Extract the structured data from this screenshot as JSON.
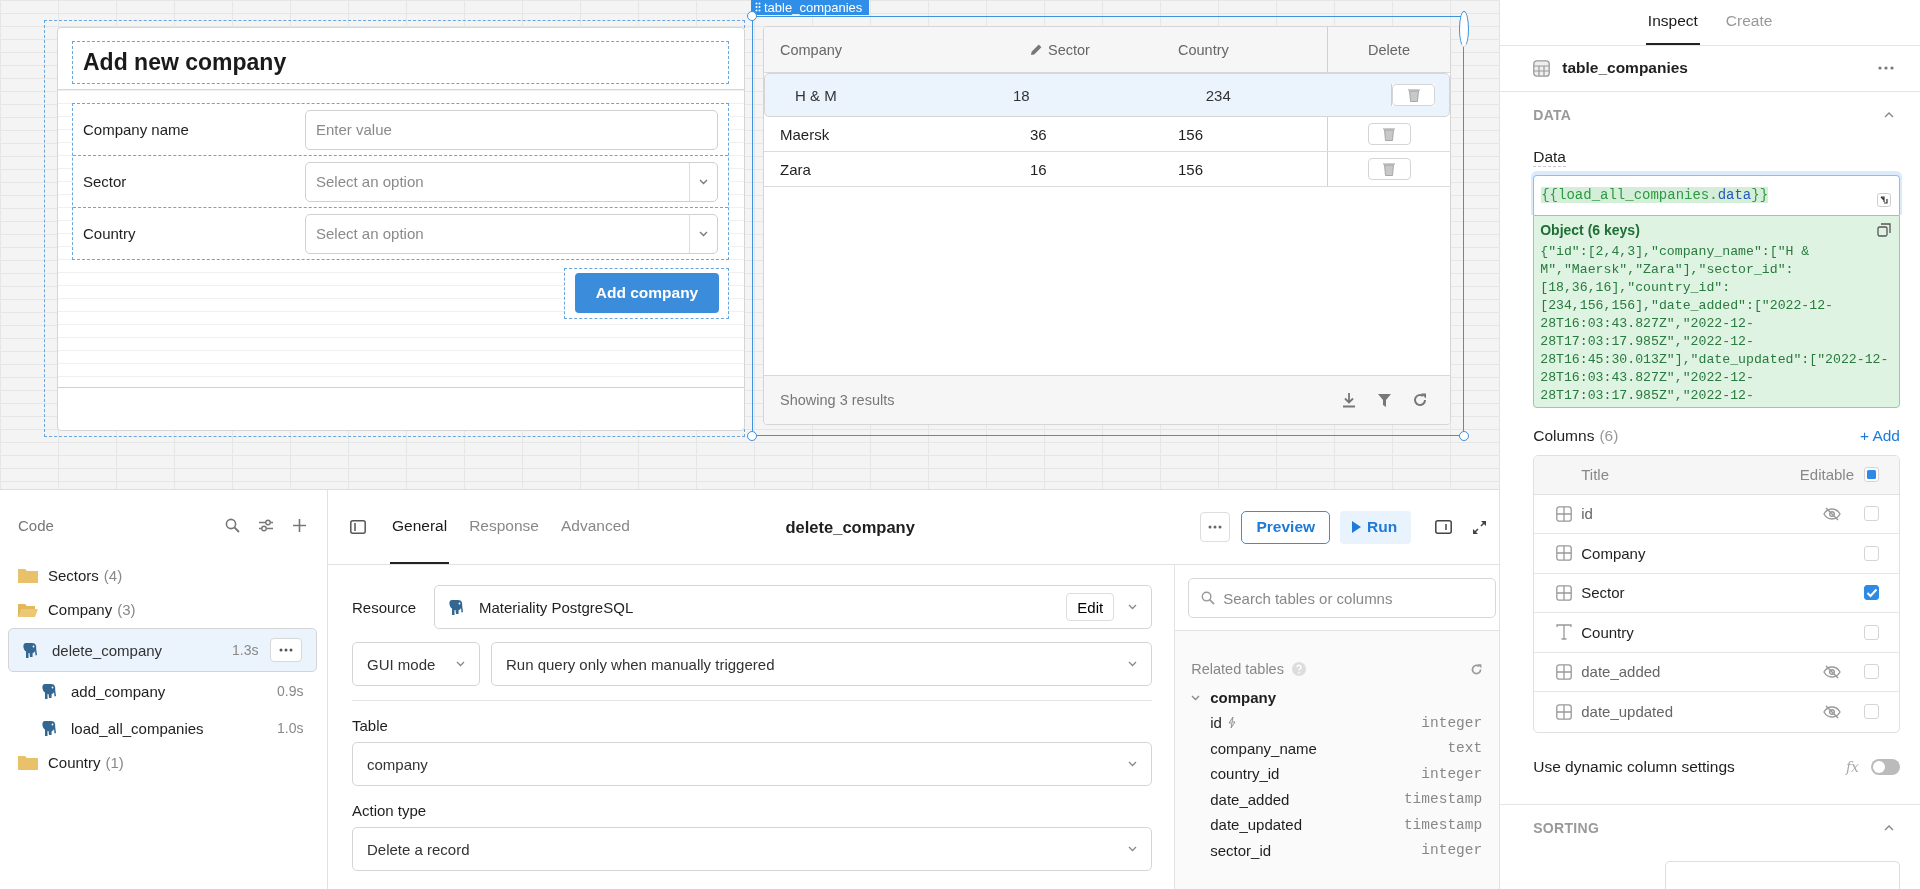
{
  "canvas": {
    "form": {
      "title": "Add new company",
      "fields": [
        {
          "label": "Company name",
          "placeholder": "Enter value",
          "kind": "text"
        },
        {
          "label": "Sector",
          "placeholder": "Select an option",
          "kind": "select"
        },
        {
          "label": "Country",
          "placeholder": "Select an option",
          "kind": "select"
        }
      ],
      "submit_button": "Add company"
    },
    "table": {
      "component_name": "table_companies",
      "columns": [
        {
          "label": "Company",
          "editable": false
        },
        {
          "label": "Sector",
          "editable": true
        },
        {
          "label": "Country",
          "editable": false
        }
      ],
      "action_column": "Delete",
      "rows": [
        {
          "cells": [
            "H & M",
            "18",
            "234"
          ],
          "selected": true
        },
        {
          "cells": [
            "Maersk",
            "36",
            "156"
          ],
          "selected": false
        },
        {
          "cells": [
            "Zara",
            "16",
            "156"
          ],
          "selected": false
        }
      ],
      "footer": "Showing 3 results"
    }
  },
  "code_panel": {
    "title": "Code",
    "tree": [
      {
        "label": "Sectors",
        "count": "(4)",
        "expanded": false
      },
      {
        "label": "Company",
        "count": "(3)",
        "expanded": true,
        "children": [
          {
            "label": "delete_company",
            "time": "1.3s",
            "selected": true
          },
          {
            "label": "add_company",
            "time": "0.9s",
            "selected": false
          },
          {
            "label": "load_all_companies",
            "time": "1.0s",
            "selected": false
          }
        ]
      },
      {
        "label": "Country",
        "count": "(1)",
        "expanded": false
      }
    ]
  },
  "query_editor": {
    "tabs": [
      {
        "label": "General",
        "selected": true
      },
      {
        "label": "Response",
        "selected": false
      },
      {
        "label": "Advanced",
        "selected": false
      }
    ],
    "title": "delete_company",
    "preview_button": "Preview",
    "run_button": "Run",
    "resource": {
      "label": "Resource",
      "value": "Materiality PostgreSQL",
      "edit_button": "Edit"
    },
    "mode": "GUI mode",
    "trigger": "Run query only when manually triggered",
    "table": {
      "label": "Table",
      "value": "company"
    },
    "action_type": {
      "label": "Action type",
      "value": "Delete a record"
    }
  },
  "schema": {
    "search_placeholder": "Search tables or columns",
    "title": "Related tables",
    "tables": [
      {
        "name": "company",
        "expanded": true,
        "children": [
          {
            "name": "id",
            "type": "integer",
            "primary_key": true
          },
          {
            "name": "company_name",
            "type": "text",
            "primary_key": false
          },
          {
            "name": "country_id",
            "type": "integer",
            "primary_key": false
          },
          {
            "name": "date_added",
            "type": "timestamp",
            "primary_key": false
          },
          {
            "name": "date_updated",
            "type": "timestamp",
            "primary_key": false
          },
          {
            "name": "sector_id",
            "type": "integer",
            "primary_key": false
          }
        ]
      }
    ]
  },
  "inspector": {
    "tabs": [
      {
        "label": "Inspect",
        "selected": true
      },
      {
        "label": "Create",
        "selected": false
      }
    ],
    "component": "table_companies",
    "data_section": {
      "title": "DATA",
      "expanded": true
    },
    "data_label": "Data",
    "data_value": [
      {
        "text": "{{load_all_companies.",
        "kind": "identifier"
      },
      {
        "text": "data",
        "kind": "property"
      },
      {
        "text": "}}",
        "kind": "identifier"
      }
    ],
    "preview_title": "Object (6 keys)",
    "preview_text": "{\"id\":[2,4,3],\"company_name\":[\"H & M\",\"Maersk\",\"Zara\"],\"sector_id\":[18,36,16],\"country_id\":[234,156,156],\"date_added\":[\"2022-12-28T16:03:43.827Z\",\"2022-12-28T17:03:17.985Z\",\"2022-12-28T16:45:30.013Z\"],\"date_updated\":[\"2022-12-28T16:03:43.827Z\",\"2022-12-28T17:03:17.985Z\",\"2022-12-",
    "columns_label": "Columns",
    "columns_count": "(6)",
    "add_button": "+ Add",
    "columns_header": {
      "title": "Title",
      "editable": "Editable",
      "indeterminate": true
    },
    "columns": [
      {
        "name": "id",
        "kind": "grid",
        "hidden": true,
        "editable": false
      },
      {
        "name": "Company",
        "kind": "grid",
        "hidden": false,
        "editable": false
      },
      {
        "name": "Sector",
        "kind": "grid",
        "hidden": false,
        "editable": true
      },
      {
        "name": "Country",
        "kind": "text",
        "hidden": false,
        "editable": false
      },
      {
        "name": "date_added",
        "kind": "grid",
        "hidden": true,
        "editable": false
      },
      {
        "name": "date_updated",
        "kind": "grid",
        "hidden": true,
        "editable": false
      }
    ],
    "dynamic_settings": {
      "label": "Use dynamic column settings",
      "formula_button": "fx",
      "on": false
    },
    "sorting_section": {
      "title": "SORTING",
      "expanded": true
    }
  }
}
